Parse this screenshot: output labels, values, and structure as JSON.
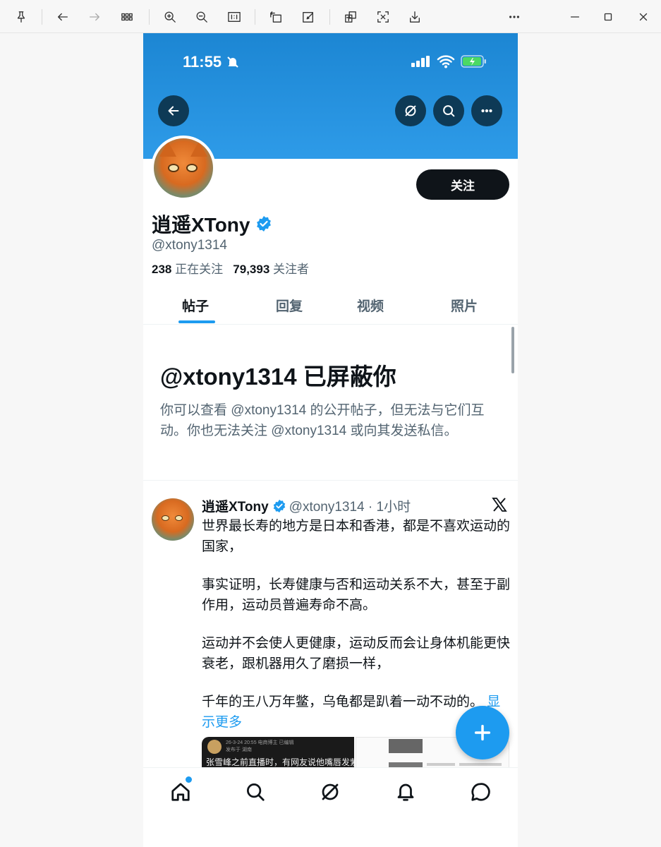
{
  "status_bar": {
    "time": "11:55"
  },
  "profile": {
    "display_name": "逍遥XTony",
    "handle": "@xtony1314",
    "following_count": "238",
    "following_label": "正在关注",
    "followers_count": "79,393",
    "followers_label": "关注者",
    "follow_button": "关注"
  },
  "tabs": [
    {
      "label": "帖子",
      "active": true
    },
    {
      "label": "回复",
      "active": false
    },
    {
      "label": "视频",
      "active": false
    },
    {
      "label": "照片",
      "active": false
    }
  ],
  "blocked_notice": {
    "title": "@xtony1314 已屏蔽你",
    "message": "你可以查看 @xtony1314 的公开帖子，但无法与它们互动。你也无法关注 @xtony1314 或向其发送私信。"
  },
  "post": {
    "author": "逍遥XTony",
    "meta": "@xtony1314 · 1小时",
    "paragraphs": [
      "世界最长寿的地方是日本和香港，都是不喜欢运动的国家，",
      "事实证明，长寿健康与否和运动关系不大，甚至于副作用，运动员普遍寿命不高。",
      "运动并不会使人更健康，运动反而会让身体机能更快衰老，跟机器用久了磨损一样，"
    ],
    "last_paragraph": "千年的王八万年鳖，乌龟都是趴着一动不动的。",
    "show_more": "显示更多",
    "media_left": {
      "line1": "26-3-24 20:55 电商博主 已编辑",
      "line2": "发布于 湖南",
      "line3": "张雪峰之前直播时，有网友说他嘴唇发紫"
    }
  },
  "colors": {
    "accent": "#1d9bf0",
    "banner": "#1c86d3",
    "text": "#0f1419",
    "muted": "#536471"
  },
  "icons": {
    "toolbar": [
      "pin-icon",
      "back-icon",
      "forward-icon",
      "grid-icon",
      "zoom-in-icon",
      "zoom-out-icon",
      "actual-size-icon",
      "rotate-icon",
      "edit-icon",
      "translate-icon",
      "ocr-icon",
      "download-icon",
      "more-icon",
      "minimize-icon",
      "maximize-icon",
      "close-icon"
    ],
    "nav": [
      "home-icon",
      "search-icon",
      "grok-icon",
      "notifications-icon",
      "messages-icon"
    ]
  }
}
